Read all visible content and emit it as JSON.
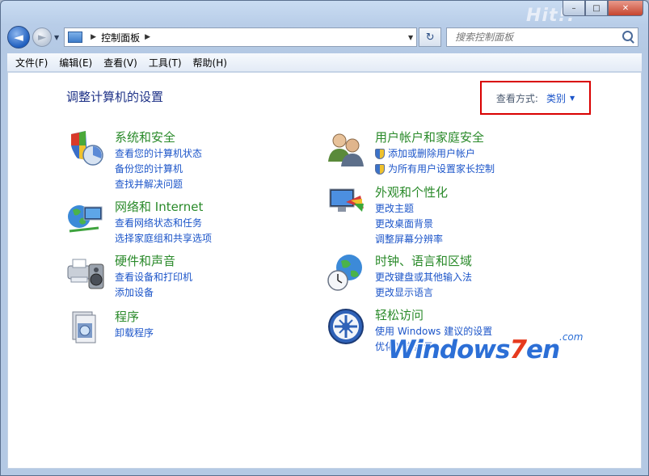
{
  "window": {
    "close_label": "✕",
    "min_label": "–",
    "max_label": "□"
  },
  "watermark_top": "Hit!!",
  "nav": {
    "back_glyph": "◄",
    "forward_glyph": "►",
    "breadcrumb_sep": "▶",
    "breadcrumb": "控制面板",
    "refresh_glyph": "↻",
    "search_placeholder": "搜索控制面板"
  },
  "menu": [
    "文件(F)",
    "编辑(E)",
    "查看(V)",
    "工具(T)",
    "帮助(H)"
  ],
  "page": {
    "title": "调整计算机的设置",
    "view_by_label": "查看方式:",
    "view_by_value": "类别"
  },
  "categories": [
    {
      "title": "系统和安全",
      "links": [
        "查看您的计算机状态",
        "备份您的计算机",
        "查找并解决问题"
      ],
      "icon": "system-security-icon"
    },
    {
      "title": "网络和 Internet",
      "links": [
        "查看网络状态和任务",
        "选择家庭组和共享选项"
      ],
      "icon": "network-icon"
    },
    {
      "title": "硬件和声音",
      "links": [
        "查看设备和打印机",
        "添加设备"
      ],
      "icon": "hardware-sound-icon"
    },
    {
      "title": "程序",
      "links": [
        "卸载程序"
      ],
      "icon": "programs-icon"
    },
    {
      "title": "用户帐户和家庭安全",
      "links": [
        "添加或删除用户帐户",
        "为所有用户设置家长控制"
      ],
      "icon": "user-accounts-icon"
    },
    {
      "title": "外观和个性化",
      "links": [
        "更改主题",
        "更改桌面背景",
        "调整屏幕分辨率"
      ],
      "icon": "appearance-icon"
    },
    {
      "title": "时钟、语言和区域",
      "links": [
        "更改键盘或其他输入法",
        "更改显示语言"
      ],
      "icon": "clock-region-icon"
    },
    {
      "title": "轻松访问",
      "links": [
        "使用 Windows 建议的设置",
        "优化视觉显示"
      ],
      "icon": "ease-of-access-icon"
    }
  ],
  "watermark": {
    "prefix": "Windows",
    "seven": "7",
    "suffix": "en",
    "com": ".com"
  },
  "colors": {
    "title": "#1e3287",
    "category": "#2a8a2a",
    "link": "#1c55c9",
    "highlight_box": "#d90000"
  }
}
